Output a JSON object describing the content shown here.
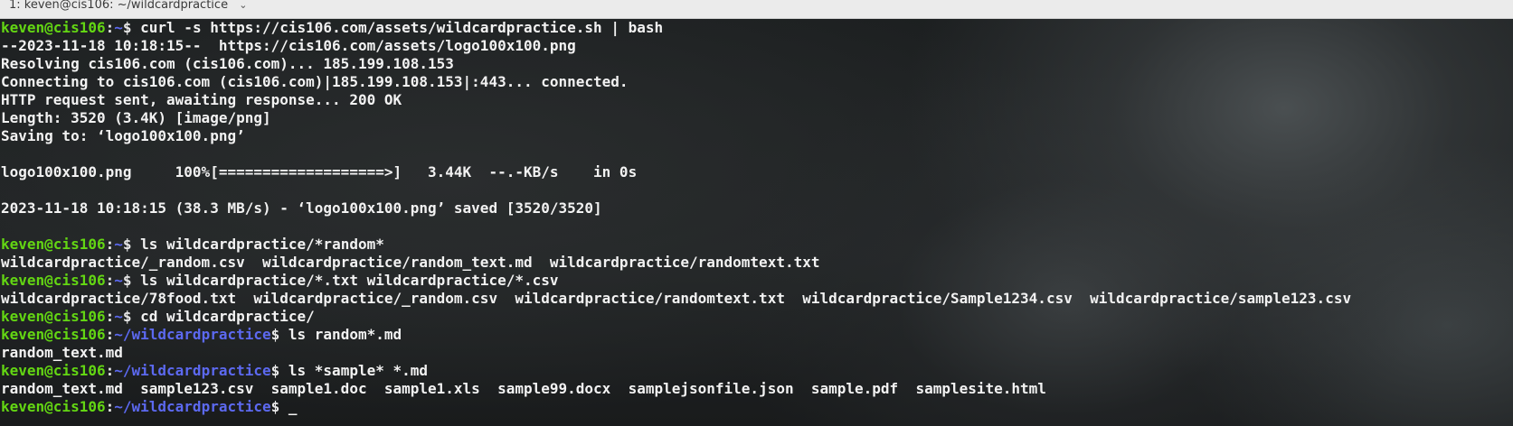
{
  "window": {
    "tab_title": "1: keven@cis106: ~/wildcardpractice",
    "tab_chevron": "⌄"
  },
  "colors": {
    "prompt_user": "#63d613",
    "prompt_path": "#5c69f0",
    "text": "#f2f2f2",
    "titlebar": "#ebebeb"
  },
  "terminal": {
    "lines": [
      {
        "type": "prompt",
        "user": "keven@cis106",
        "colon": ":",
        "path": "~",
        "dollar": "$ ",
        "cmd": "curl -s https://cis106.com/assets/wildcardpractice.sh | bash"
      },
      {
        "type": "output",
        "text": "--2023-11-18 10:18:15--  https://cis106.com/assets/logo100x100.png"
      },
      {
        "type": "output",
        "text": "Resolving cis106.com (cis106.com)... 185.199.108.153"
      },
      {
        "type": "output",
        "text": "Connecting to cis106.com (cis106.com)|185.199.108.153|:443... connected."
      },
      {
        "type": "output",
        "text": "HTTP request sent, awaiting response... 200 OK"
      },
      {
        "type": "output",
        "text": "Length: 3520 (3.4K) [image/png]"
      },
      {
        "type": "output",
        "text": "Saving to: ‘logo100x100.png’"
      },
      {
        "type": "output",
        "text": ""
      },
      {
        "type": "output",
        "text": "logo100x100.png     100%[===================>]   3.44K  --.-KB/s    in 0s"
      },
      {
        "type": "output",
        "text": ""
      },
      {
        "type": "output",
        "text": "2023-11-18 10:18:15 (38.3 MB/s) - ‘logo100x100.png’ saved [3520/3520]"
      },
      {
        "type": "output",
        "text": ""
      },
      {
        "type": "prompt",
        "user": "keven@cis106",
        "colon": ":",
        "path": "~",
        "dollar": "$ ",
        "cmd": "ls wildcardpractice/*random*"
      },
      {
        "type": "output",
        "text": "wildcardpractice/_random.csv  wildcardpractice/random_text.md  wildcardpractice/randomtext.txt"
      },
      {
        "type": "prompt",
        "user": "keven@cis106",
        "colon": ":",
        "path": "~",
        "dollar": "$ ",
        "cmd": "ls wildcardpractice/*.txt wildcardpractice/*.csv"
      },
      {
        "type": "output",
        "text": "wildcardpractice/78food.txt  wildcardpractice/_random.csv  wildcardpractice/randomtext.txt  wildcardpractice/Sample1234.csv  wildcardpractice/sample123.csv"
      },
      {
        "type": "prompt",
        "user": "keven@cis106",
        "colon": ":",
        "path": "~",
        "dollar": "$ ",
        "cmd": "cd wildcardpractice/"
      },
      {
        "type": "prompt",
        "user": "keven@cis106",
        "colon": ":",
        "path": "~/wildcardpractice",
        "dollar": "$ ",
        "cmd": "ls random*.md"
      },
      {
        "type": "output",
        "text": "random_text.md"
      },
      {
        "type": "prompt",
        "user": "keven@cis106",
        "colon": ":",
        "path": "~/wildcardpractice",
        "dollar": "$ ",
        "cmd": "ls *sample* *.md"
      },
      {
        "type": "output",
        "text": "random_text.md  sample123.csv  sample1.doc  sample1.xls  sample99.docx  samplejsonfile.json  sample.pdf  samplesite.html"
      },
      {
        "type": "prompt",
        "user": "keven@cis106",
        "colon": ":",
        "path": "~/wildcardpractice",
        "dollar": "$ ",
        "cmd": "",
        "cursor": "_"
      }
    ]
  }
}
